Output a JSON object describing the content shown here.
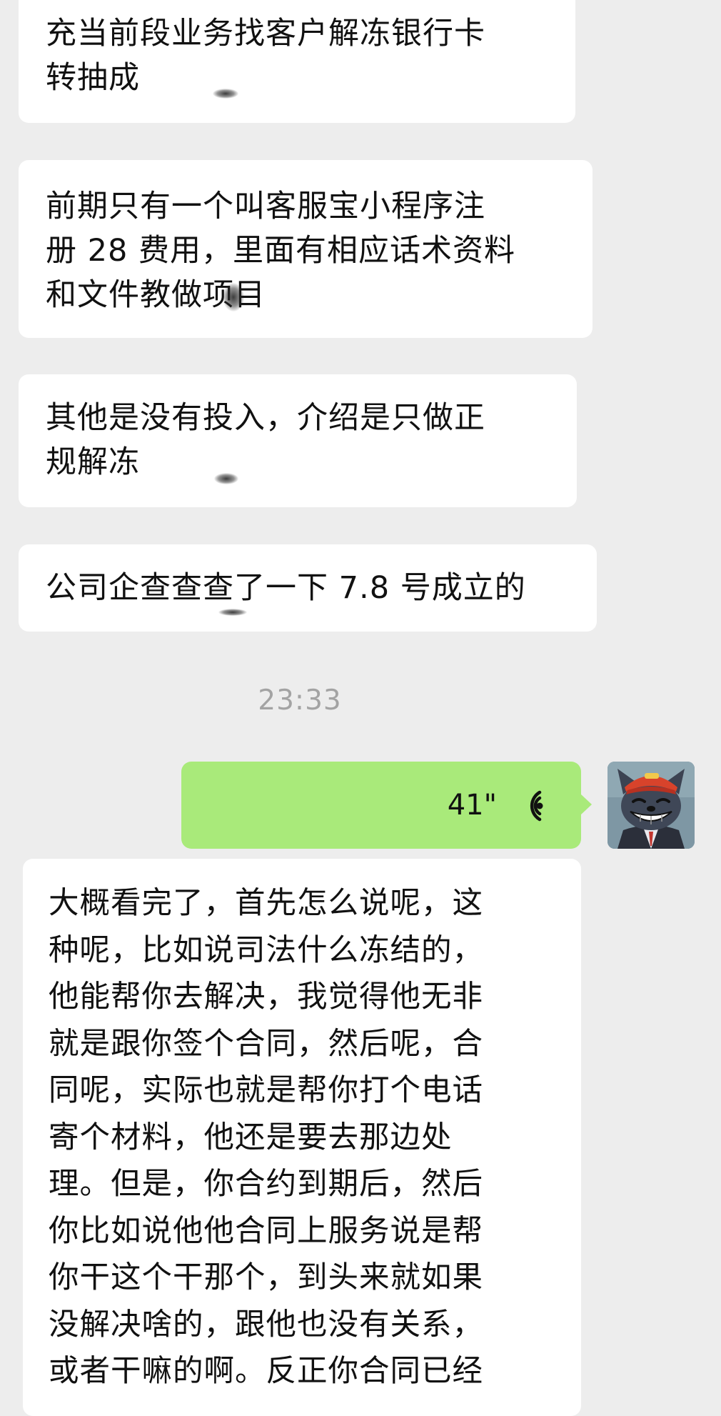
{
  "messages": [
    {
      "from": "contact",
      "lines": [
        "充当前段业务找客户解冻银行卡",
        "转抽成"
      ]
    },
    {
      "from": "contact",
      "lines": [
        "前期只有一个叫客服宝小程序注",
        "册 28 费用，里面有相应话术资料",
        "和文件教做项目"
      ]
    },
    {
      "from": "contact",
      "lines": [
        "其他是没有投入，介绍是只做正",
        "规解冻"
      ]
    },
    {
      "from": "contact",
      "lines": [
        "公司企查查查了一下 7.8 号成立的"
      ]
    }
  ],
  "timestamp": "23:33",
  "voice_message": {
    "from": "me",
    "duration": "41\"",
    "icon": "voice-wave-icon"
  },
  "reply": {
    "from": "contact",
    "lines": [
      "大概看完了，首先怎么说呢，这",
      "种呢，比如说司法什么冻结的，",
      "他能帮你去解决，我觉得他无非",
      "就是跟你签个合同，然后呢，合",
      "同呢，实际也就是帮你打个电话",
      "寄个材料，他还是要去那边处",
      "理。但是，你合约到期后，然后",
      "你比如说他他合同上服务说是帮",
      "你干这个干那个，到头来就如果",
      "没解决啥的，跟他也没有关系，",
      "或者干嘛的啊。反正你合同已经"
    ]
  },
  "avatar": {
    "icon": "cartoon-wolf-avatar"
  },
  "colors": {
    "background": "#ededed",
    "incoming_bubble": "#ffffff",
    "outgoing_bubble": "#a9ea7a",
    "timestamp_text": "#a3a3a3"
  }
}
